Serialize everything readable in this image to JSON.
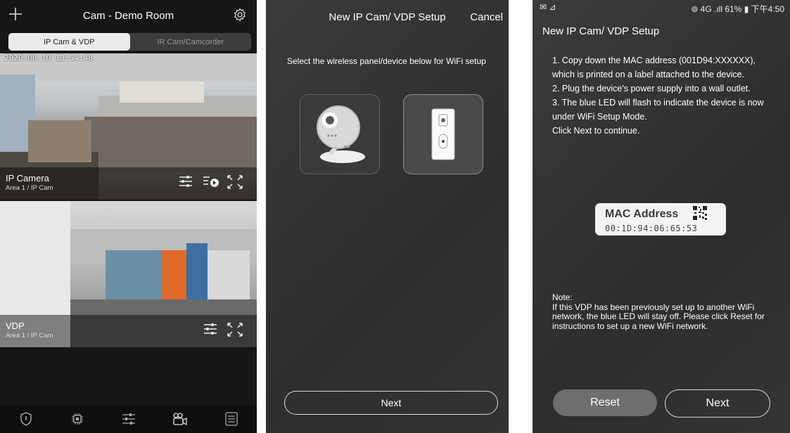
{
  "panel1": {
    "header": {
      "title": "Cam - Demo Room",
      "left_icon": "plus-icon",
      "right_icon": "gear-icon"
    },
    "segments": [
      {
        "label": "IP Cam & VDP",
        "active": true
      },
      {
        "label": "IR Cam/Camcorder",
        "active": false
      }
    ],
    "cameras": [
      {
        "timestamp": "2020-06-10 13:54:48",
        "name": "IP Camera",
        "sub": "Area 1 / IP Cam",
        "icons": [
          "sliders-icon",
          "playback-icon",
          "fullscreen-icon"
        ]
      },
      {
        "timestamp": "",
        "name": "VDP",
        "sub": "Area 1 / IP Cam",
        "icons": [
          "sliders-icon",
          "fullscreen-icon"
        ]
      }
    ],
    "tabbar": [
      "shield-icon",
      "chip-icon",
      "sliders-icon",
      "camcorder-icon",
      "list-icon"
    ]
  },
  "panel2": {
    "title": "New IP Cam/ VDP Setup",
    "cancel": "Cancel",
    "instruction": "Select the wireless panel/device below for WiFi setup",
    "devices": [
      {
        "icon": "ip-camera-icon",
        "selected": false
      },
      {
        "icon": "doorbell-icon",
        "selected": true
      }
    ],
    "next": "Next"
  },
  "panel3": {
    "status": {
      "left": "✉ ⊿",
      "right": "⊚ 4G .ıll 61% ▮ 下午4:50"
    },
    "title": "New IP Cam/ VDP Setup",
    "steps": [
      "1. Copy down the MAC address (001D94:XXXXXX), which is printed on a label attached to the device.",
      "2. Plug the device's power supply into a wall outlet.",
      "3. The blue LED will flash to indicate the device is now under WiFi Setup Mode.",
      "Click Next to continue."
    ],
    "mac_label": {
      "title": "MAC Address",
      "value": "00:1D:94:06:65:53"
    },
    "note_title": "Note:",
    "note_text": "If this VDP has been previously set up to another WiFi network, the blue LED will stay off. Please click Reset for instructions to set up a new WiFi network.",
    "reset": "Reset",
    "next": "Next"
  }
}
